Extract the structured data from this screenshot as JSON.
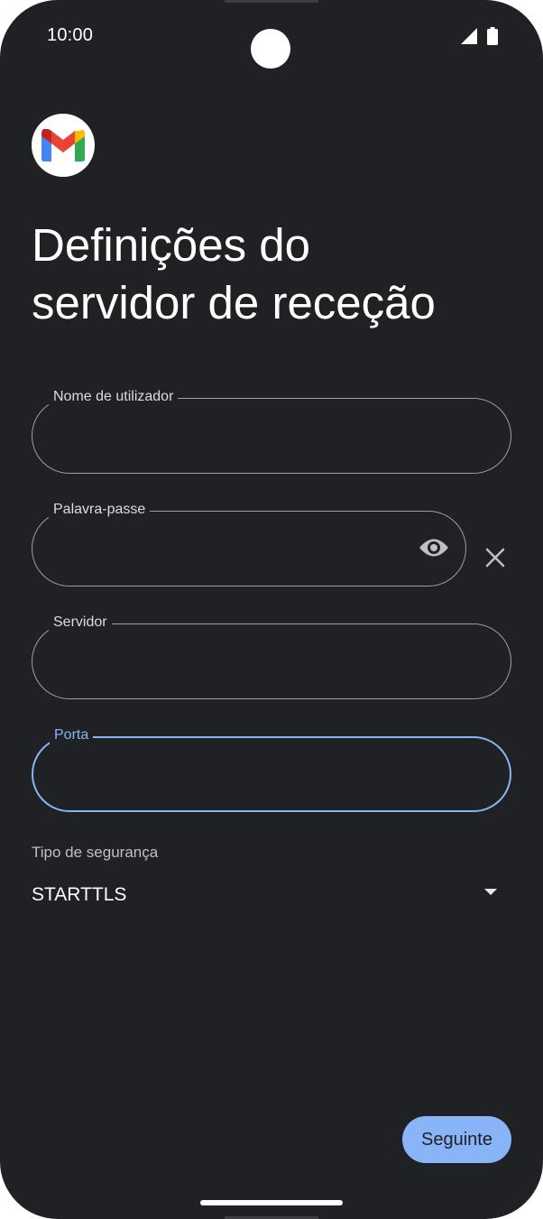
{
  "status_bar": {
    "time": "10:00"
  },
  "app": {
    "logo_icon": "gmail-logo-icon"
  },
  "page": {
    "title_line1": "Definições do",
    "title_line2": "servidor de receção"
  },
  "form": {
    "username": {
      "label": "Nome de utilizador",
      "value": ""
    },
    "password": {
      "label": "Palavra-passe",
      "value": "",
      "visibility_icon": "eye-icon",
      "clear_icon": "close-icon"
    },
    "server": {
      "label": "Servidor",
      "value": ""
    },
    "port": {
      "label": "Porta",
      "value": "",
      "focused": true
    },
    "security": {
      "label": "Tipo de segurança",
      "selected": "STARTTLS",
      "arrow_icon": "dropdown-arrow-icon"
    }
  },
  "actions": {
    "next_label": "Seguinte"
  },
  "colors": {
    "background": "#202124",
    "accent": "#8ab4f8",
    "outline": "#9aa0a6"
  }
}
